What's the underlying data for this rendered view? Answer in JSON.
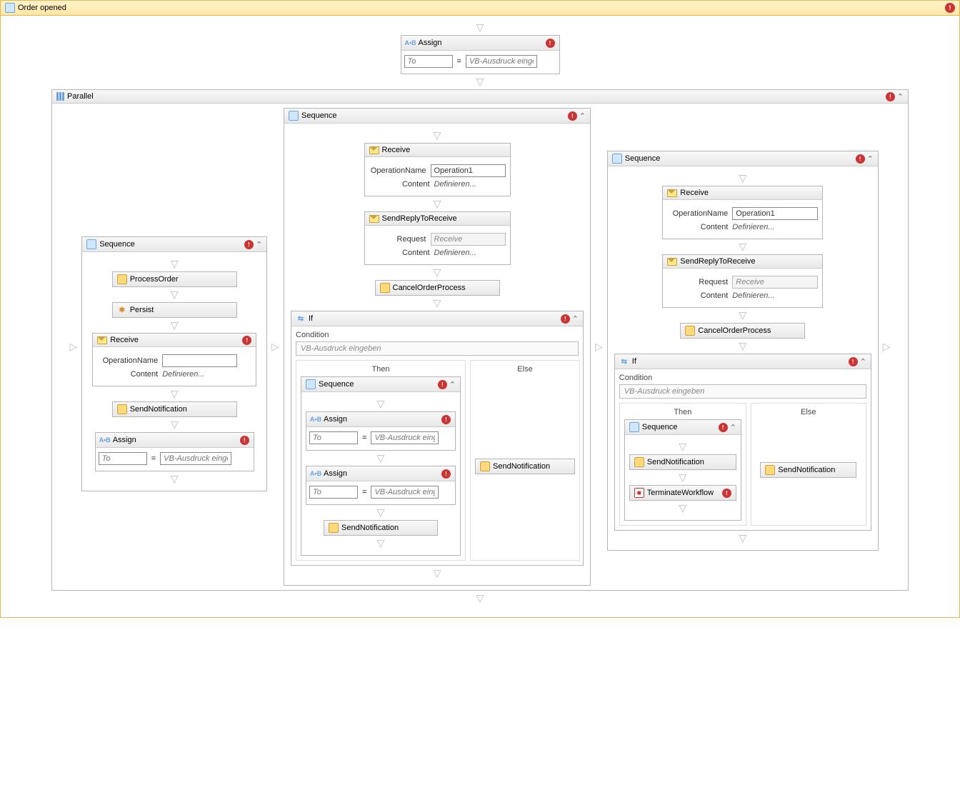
{
  "root": {
    "title": "Order opened"
  },
  "labels": {
    "assign": "Assign",
    "to_ph": "To",
    "expr_ph": "VB-Ausdruck einge",
    "parallel": "Parallel",
    "sequence": "Sequence",
    "process_order": "ProcessOrder",
    "persist": "Persist",
    "receive": "Receive",
    "op_name": "OperationName",
    "content": "Content",
    "define": "Definieren...",
    "send_notif": "SendNotification",
    "send_reply": "SendReplyToReceive",
    "request": "Request",
    "receive_val": "Receive",
    "cancel_proc": "CancelOrderProcess",
    "if": "If",
    "condition": "Condition",
    "cond_ph": "VB-Ausdruck eingeben",
    "then": "Then",
    "else": "Else",
    "terminate": "TerminateWorkflow",
    "op1": "Operation1"
  }
}
